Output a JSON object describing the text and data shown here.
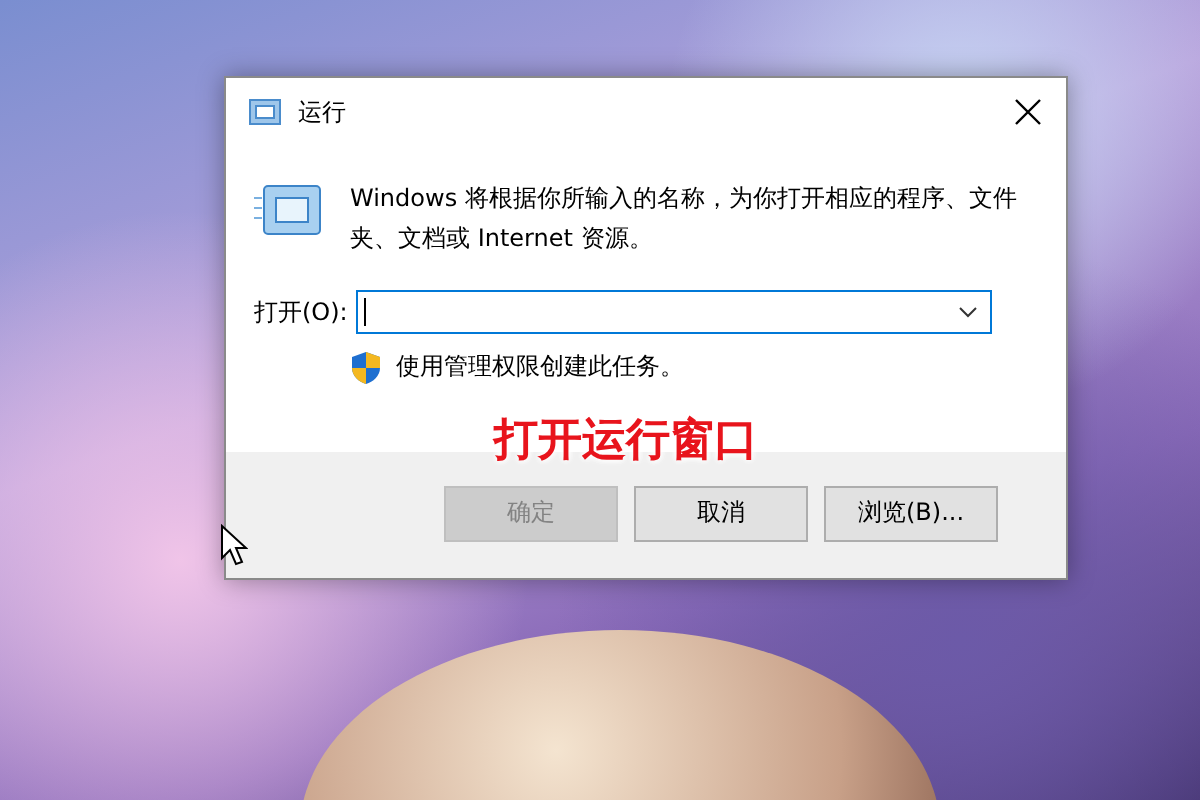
{
  "window": {
    "title": "运行"
  },
  "description": "Windows 将根据你所输入的名称，为你打开相应的程序、文件夹、文档或 Internet 资源。",
  "open_label": "打开(O):",
  "command_field": {
    "focused": true
  },
  "admin_note": "使用管理权限创建此任务。",
  "annotation": "打开运行窗口",
  "buttons": [
    {
      "label": "确定",
      "disabled": true
    },
    {
      "label": "取消",
      "disabled": false
    },
    {
      "label": "浏览(B)...",
      "disabled": false
    }
  ]
}
